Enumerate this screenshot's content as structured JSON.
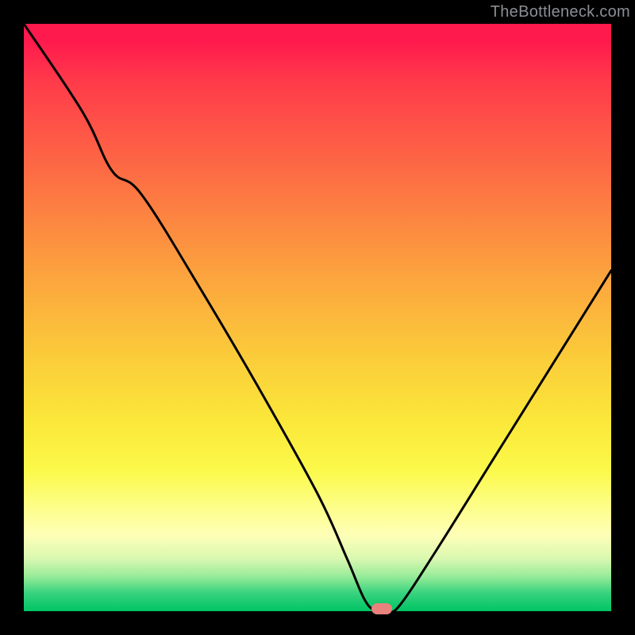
{
  "attribution": "TheBottleneck.com",
  "chart_data": {
    "type": "line",
    "title": "",
    "xlabel": "",
    "ylabel": "",
    "xlim": [
      0,
      100
    ],
    "ylim": [
      0,
      100
    ],
    "grid": false,
    "legend": false,
    "series": [
      {
        "name": "bottleneck-curve",
        "x": [
          0,
          10,
          15,
          20,
          30,
          40,
          50,
          55,
          58,
          60,
          62,
          64,
          70,
          80,
          90,
          100
        ],
        "y": [
          100,
          85,
          75,
          71,
          55,
          38,
          20,
          9,
          2,
          0,
          0,
          1,
          10,
          26,
          42,
          58
        ]
      }
    ],
    "marker": {
      "x_center": 61,
      "width_pct": 3.5,
      "color": "#e9817d"
    },
    "background_gradient": [
      {
        "stop": 0.0,
        "color": "#ff1a4d"
      },
      {
        "stop": 0.25,
        "color": "#fd6b44"
      },
      {
        "stop": 0.56,
        "color": "#fbca3a"
      },
      {
        "stop": 0.82,
        "color": "#fdfe86"
      },
      {
        "stop": 0.97,
        "color": "#36d27d"
      },
      {
        "stop": 1.0,
        "color": "#00c465"
      }
    ]
  }
}
